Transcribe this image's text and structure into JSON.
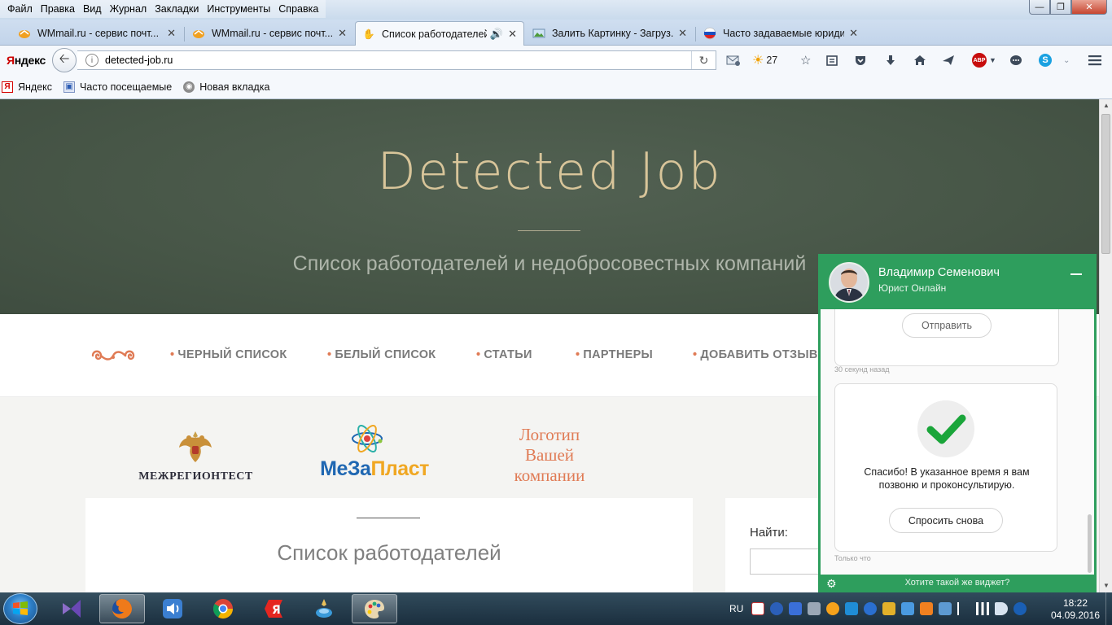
{
  "window": {
    "menu": [
      "Файл",
      "Правка",
      "Вид",
      "Журнал",
      "Закладки",
      "Инструменты",
      "Справка"
    ]
  },
  "tabs": [
    {
      "title": "WMmail.ru - сервис почт...",
      "active": false
    },
    {
      "title": "WMmail.ru - сервис почт...",
      "active": false
    },
    {
      "title": "Список работодателей",
      "active": true
    },
    {
      "title": "Залить Картинку - Загруз...",
      "active": false
    },
    {
      "title": "Часто задаваемые юриди...",
      "active": false
    }
  ],
  "navbar": {
    "yandex_logo_red": "Я",
    "yandex_logo_rest": "ндекс",
    "url": "detected-job.ru",
    "weather_temp": "27"
  },
  "bookmarks": [
    "Яндекс",
    "Часто посещаемые",
    "Новая вкладка"
  ],
  "site": {
    "title": "Detected Job",
    "subtitle": "Список работодателей и недобросовестных компаний",
    "nav": [
      "ЧЕРНЫЙ СПИСОК",
      "БЕЛЫЙ СПИСОК",
      "СТАТЬИ",
      "ПАРТНЕРЫ",
      "ДОБАВИТЬ ОТЗЫВ"
    ],
    "nav_bullet": "•",
    "partners": {
      "mrt": "МЕЖРЕГИОНТЕСТ",
      "meza_part1": "МеЗа",
      "meza_part2": "Пласт",
      "placeholder_lines": [
        "Логотип",
        "Вашей",
        "компании"
      ]
    },
    "content_heading": "Список работодателей",
    "search_label": "Найти:"
  },
  "chat": {
    "agent_name": "Владимир Семенович",
    "agent_role": "Юрист Онлайн",
    "send_button": "Отправить",
    "time1": "30 секунд назад",
    "thanks": "Спасибо! В указанное время я вам позвоню и проконсультирую.",
    "ask_again_button": "Спросить снова",
    "time2": "Только что",
    "footer_link": "Хотите такой же виджет?",
    "colors": {
      "brand": "#2e9e5d"
    }
  },
  "taskbar": {
    "lang": "RU",
    "time": "18:22",
    "date": "04.09.2016"
  },
  "colors": {
    "hero_bg": "#475647",
    "title_gold": "#d8c59a",
    "accent_orange": "#e07b55",
    "nav_text": "#7a7a7a"
  }
}
